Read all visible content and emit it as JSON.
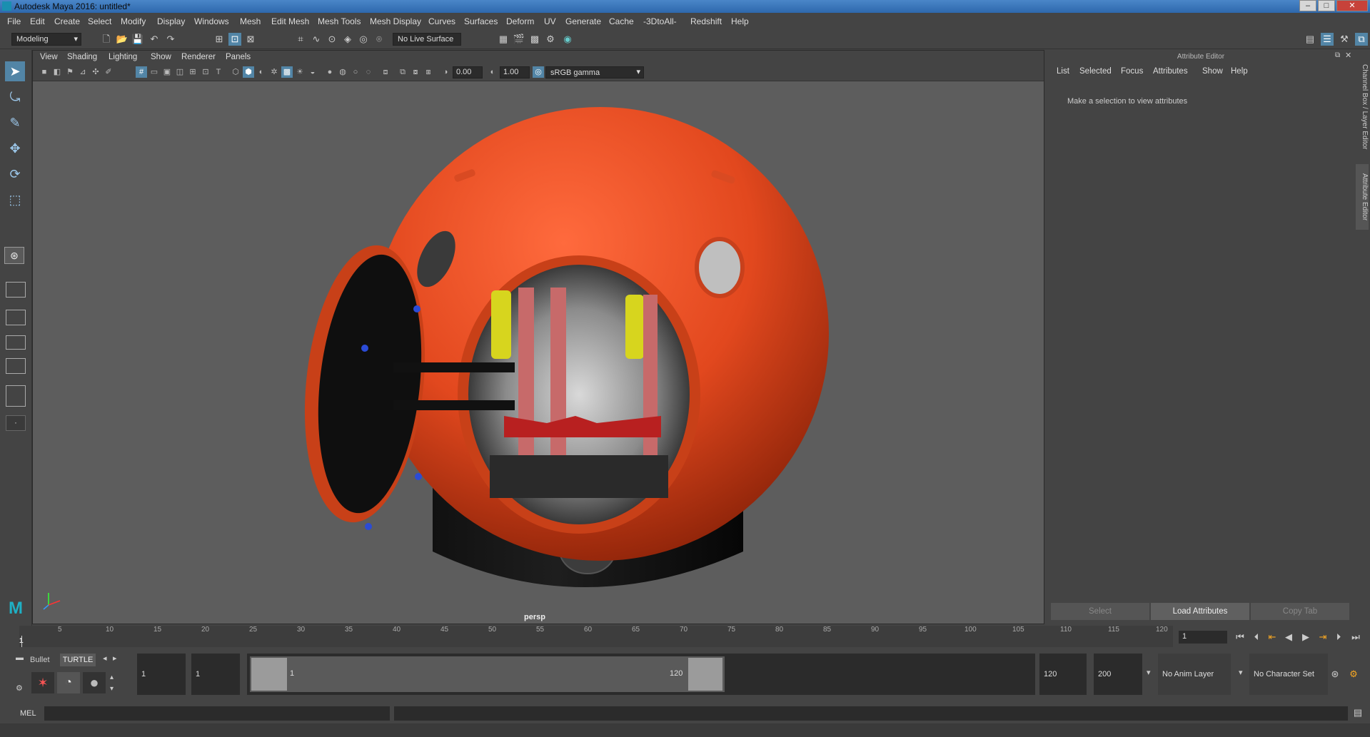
{
  "window": {
    "title": "Autodesk Maya 2016: untitled*",
    "minimize": "–",
    "maximize": "□",
    "close": "✕"
  },
  "menubar": [
    "File",
    "Edit",
    "Create",
    "Select",
    "Modify",
    "Display",
    "Windows",
    "Mesh",
    "Edit Mesh",
    "Mesh Tools",
    "Mesh Display",
    "Curves",
    "Surfaces",
    "Deform",
    "UV",
    "Generate",
    "Cache",
    "-3DtoAll-",
    "Redshift",
    "Help"
  ],
  "statusline": {
    "mode": "Modeling",
    "live_surface": "No Live Surface"
  },
  "viewport": {
    "menus": [
      "View",
      "Shading",
      "Lighting",
      "Show",
      "Renderer",
      "Panels"
    ],
    "exposure": "0.00",
    "gamma": "1.00",
    "color_space": "sRGB gamma",
    "camera": "persp"
  },
  "attribute_editor": {
    "title": "Attribute Editor",
    "menus": [
      "List",
      "Selected",
      "Focus",
      "Attributes",
      "Show",
      "Help"
    ],
    "message": "Make a selection to view attributes",
    "buttons": {
      "select": "Select",
      "load": "Load Attributes",
      "copy": "Copy Tab"
    }
  },
  "side_tabs": [
    "Channel Box / Layer Editor",
    "Attribute Editor"
  ],
  "timeslider": {
    "ticks": [
      "5",
      "10",
      "15",
      "20",
      "25",
      "30",
      "35",
      "40",
      "45",
      "50",
      "55",
      "60",
      "65",
      "70",
      "75",
      "80",
      "85",
      "90",
      "95",
      "100",
      "105",
      "110",
      "115",
      "120"
    ],
    "start_label": "1",
    "current_frame": "1"
  },
  "range": {
    "shelf_tabs": [
      "Bullet",
      "TURTLE"
    ],
    "start": "1",
    "playback_start": "1",
    "range_start_label": "1",
    "range_end_label": "120",
    "playback_end": "120",
    "end": "200",
    "anim_layer": "No Anim Layer",
    "character_set": "No Character Set"
  },
  "cmdline": {
    "label": "MEL"
  }
}
